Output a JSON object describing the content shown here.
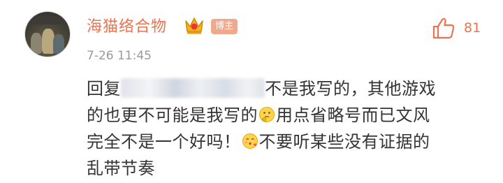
{
  "comment": {
    "author": "海猫络合物",
    "author_badge": "博主",
    "timestamp": "7-26 11:45",
    "likes": "81",
    "icons": {
      "crown": "crown-icon",
      "like": "thumbs-up-icon",
      "emoji_1": "thinking-face-icon",
      "emoji_2": "face-blowing-kiss-icon"
    },
    "lines": {
      "l1_prefix": "回复",
      "l1_suffix": "不是我写的，其他游戏",
      "l2_part1": "的也更不可能是我写的",
      "l2_part2": "用点省略号而已文风",
      "l3_part1": "完全不是一个好吗！",
      "l3_part2": "不要听某些没有证据的",
      "l4": "乱带节奏"
    }
  },
  "colors": {
    "accent": "#eb7350",
    "badge_bg": "#f0a98e",
    "text": "#333333",
    "muted": "#9a9a9a"
  }
}
